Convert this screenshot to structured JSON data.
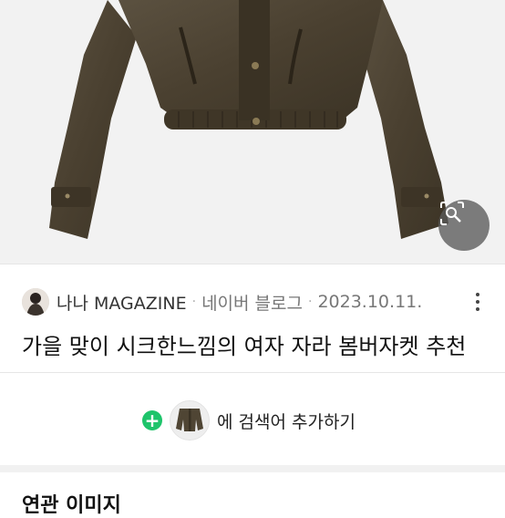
{
  "source": {
    "name": "나나 MAGAZINE",
    "separator": "·",
    "platform": "네이버 블로그",
    "date": "2023.10.11."
  },
  "title": "가을 맞이 시크한느낌의 여자 자라 봄버자켓 추천",
  "add_search": {
    "plus": "+",
    "label": "에 검색어 추가하기"
  },
  "section": {
    "title": "연관 이미지"
  },
  "icons": {
    "lens": "image-search-icon",
    "more": "more-vertical-icon",
    "plus": "plus-icon"
  },
  "colors": {
    "accent_green": "#1ec46b",
    "jacket": "#4f4534"
  }
}
